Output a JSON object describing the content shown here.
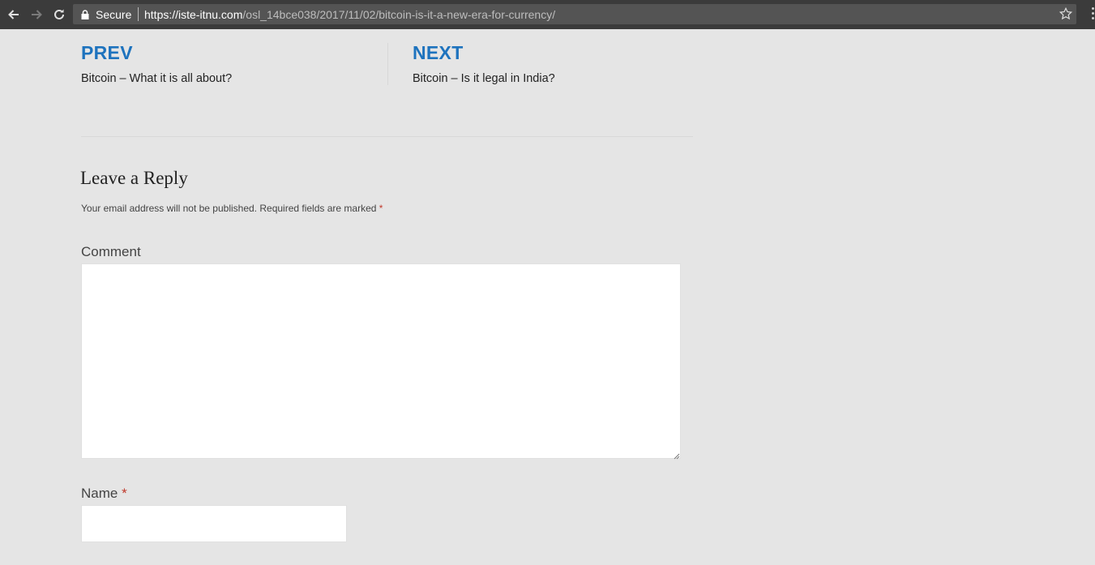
{
  "browser": {
    "secure_label": "Secure",
    "url_domain": "https://iste-itnu.com",
    "url_path": "/osl_14bce038/2017/11/02/bitcoin-is-it-a-new-era-for-currency/",
    "icons": [
      "back-arrow-icon",
      "forward-arrow-icon",
      "reload-icon",
      "lock-icon",
      "star-icon",
      "menu-icon"
    ]
  },
  "post_nav": {
    "prev_label": "PREV",
    "prev_title": "Bitcoin – What it is all about?",
    "next_label": "NEXT",
    "next_title": "Bitcoin – Is it legal in India?"
  },
  "reply": {
    "heading": "Leave a Reply",
    "notes": "Your email address will not be published. Required fields are marked",
    "required_mark": "*",
    "comment_label": "Comment",
    "comment_value": "",
    "name_label": "Name",
    "name_value": ""
  },
  "colors": {
    "accent": "#1e73be",
    "page_bg": "#e5e5e5",
    "required": "#c0392b"
  }
}
